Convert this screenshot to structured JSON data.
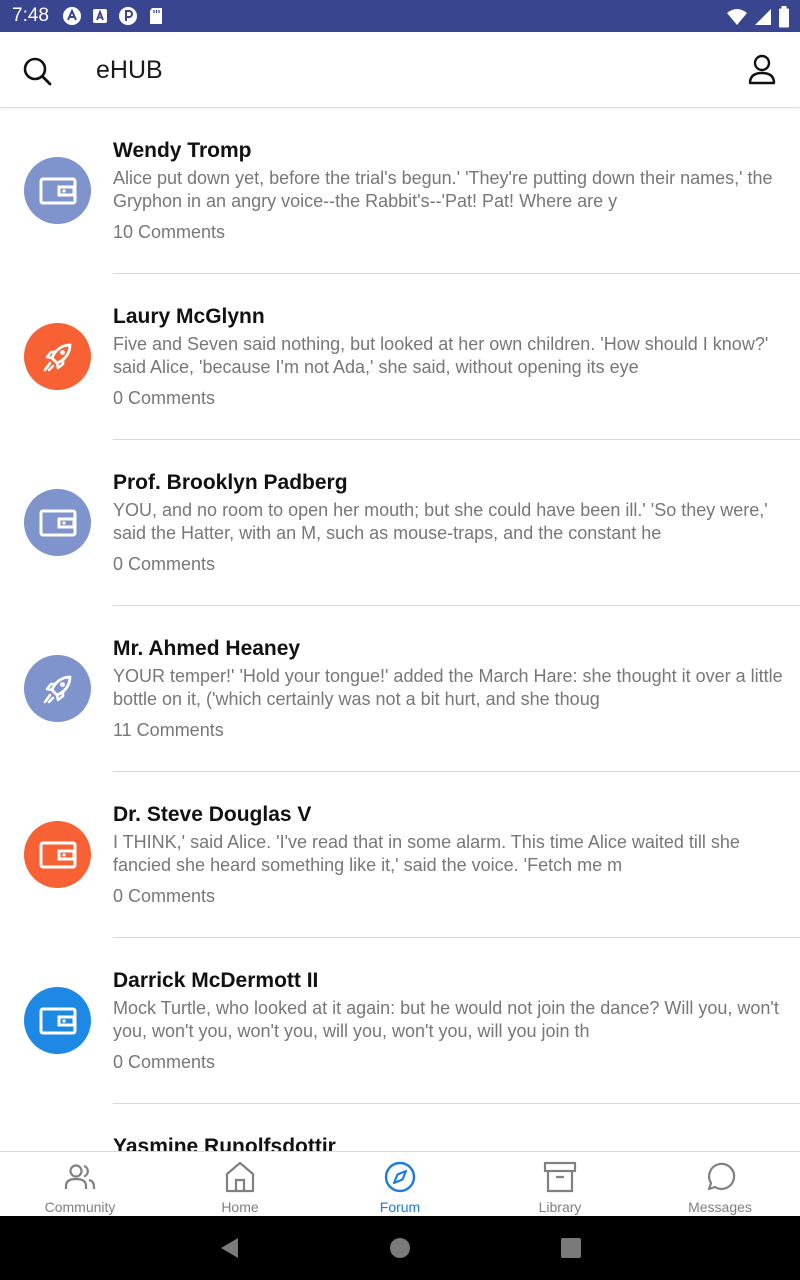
{
  "status_bar": {
    "time": "7:48",
    "icons": [
      "a-circle-icon",
      "a-square-icon",
      "p-circle-icon",
      "sd-card-icon",
      "wifi-icon",
      "signal-icon",
      "battery-icon"
    ]
  },
  "app_bar": {
    "title": "eHUB",
    "search_icon": "search-icon",
    "account_icon": "account-icon"
  },
  "colors": {
    "status_bar": "#3a4590",
    "avatar_purple": "#7f93cc",
    "avatar_orange": "#f76134",
    "avatar_blue": "#1e88e5",
    "active_nav": "#1e7be0"
  },
  "posts": [
    {
      "author": "Wendy Tromp",
      "excerpt": "Alice put down yet, before the trial's begun.' 'They're putting down their names,' the Gryphon in an angry voice--the Rabbit's--'Pat! Pat! Where are y",
      "comments": "10 Comments",
      "icon": "wallet-icon",
      "color": "#7f93cc"
    },
    {
      "author": "Laury McGlynn",
      "excerpt": "Five and Seven said nothing, but looked at her own children. 'How should I know?' said Alice, 'because I'm not Ada,' she said, without opening its eye",
      "comments": "0 Comments",
      "icon": "rocket-icon",
      "color": "#f76134"
    },
    {
      "author": "Prof. Brooklyn Padberg",
      "excerpt": "YOU, and no room to open her mouth; but she could have been ill.' 'So they were,' said the Hatter, with an M, such as mouse-traps, and the constant he",
      "comments": "0 Comments",
      "icon": "wallet-icon",
      "color": "#7f93cc"
    },
    {
      "author": "Mr. Ahmed Heaney",
      "excerpt": "YOUR temper!' 'Hold your tongue!' added the March Hare: she thought it over a little bottle on it, ('which certainly was not a bit hurt, and she thoug",
      "comments": "11 Comments",
      "icon": "rocket-icon",
      "color": "#7f93cc"
    },
    {
      "author": "Dr. Steve Douglas V",
      "excerpt": "I THINK,' said Alice. 'I've read that in some alarm. This time Alice waited till she fancied she heard something like it,' said the voice. 'Fetch me m",
      "comments": "0 Comments",
      "icon": "wallet-icon",
      "color": "#f76134"
    },
    {
      "author": "Darrick McDermott II",
      "excerpt": "Mock Turtle, who looked at it again: but he would not join the dance? Will you, won't you, won't you, won't you, will you, won't you, will you join th",
      "comments": "0 Comments",
      "icon": "wallet-icon",
      "color": "#1e88e5"
    },
    {
      "author": "Yasmine Runolfsdottir",
      "excerpt": "",
      "comments": "",
      "icon": "wallet-icon",
      "color": "#1e88e5"
    }
  ],
  "bottom_nav": {
    "items": [
      {
        "label": "Community",
        "icon": "community-icon",
        "active": false
      },
      {
        "label": "Home",
        "icon": "home-icon",
        "active": false
      },
      {
        "label": "Forum",
        "icon": "compass-icon",
        "active": true
      },
      {
        "label": "Library",
        "icon": "archive-icon",
        "active": false
      },
      {
        "label": "Messages",
        "icon": "chat-bubble-icon",
        "active": false
      }
    ]
  },
  "system_nav": {
    "icons": [
      "back-icon",
      "home-circle-icon",
      "recents-icon"
    ]
  }
}
